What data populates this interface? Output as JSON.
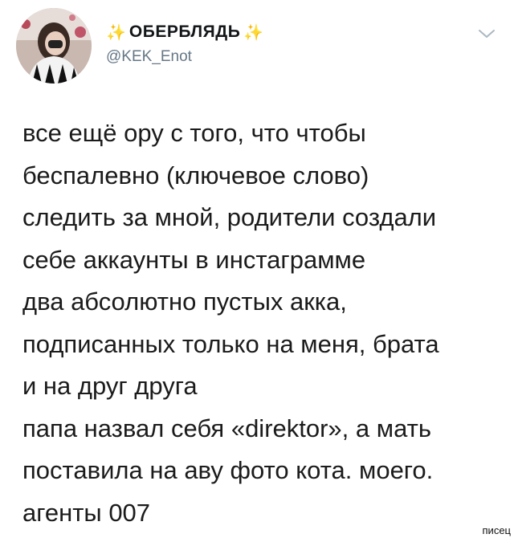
{
  "header": {
    "display_name": "ОБЕРБЛЯДЬ",
    "sparkle_left": "✨",
    "sparkle_right": "✨",
    "handle": "@KEK_Enot"
  },
  "icons": {
    "avatar": "avatar-photo",
    "menu": "chevron-down-icon"
  },
  "tweet": {
    "lines": [
      "все ещё ору с того, что чтобы",
      "беспалевно (ключевое слово)",
      "следить за мной, родители создали",
      "себе аккаунты в инстаграмме",
      "два абсолютно пустых акка,",
      "подписанных только на меня, брата",
      "и на друг друга",
      "папа назвал себя «direktor», а мать",
      "поставила на аву фото кота. моего.",
      "агенты 007"
    ]
  },
  "watermark": "писец",
  "colors": {
    "text": "#1b1b1b",
    "handle": "#657786",
    "sparkle": "#e8c23a",
    "chevron": "#aab8c2"
  }
}
